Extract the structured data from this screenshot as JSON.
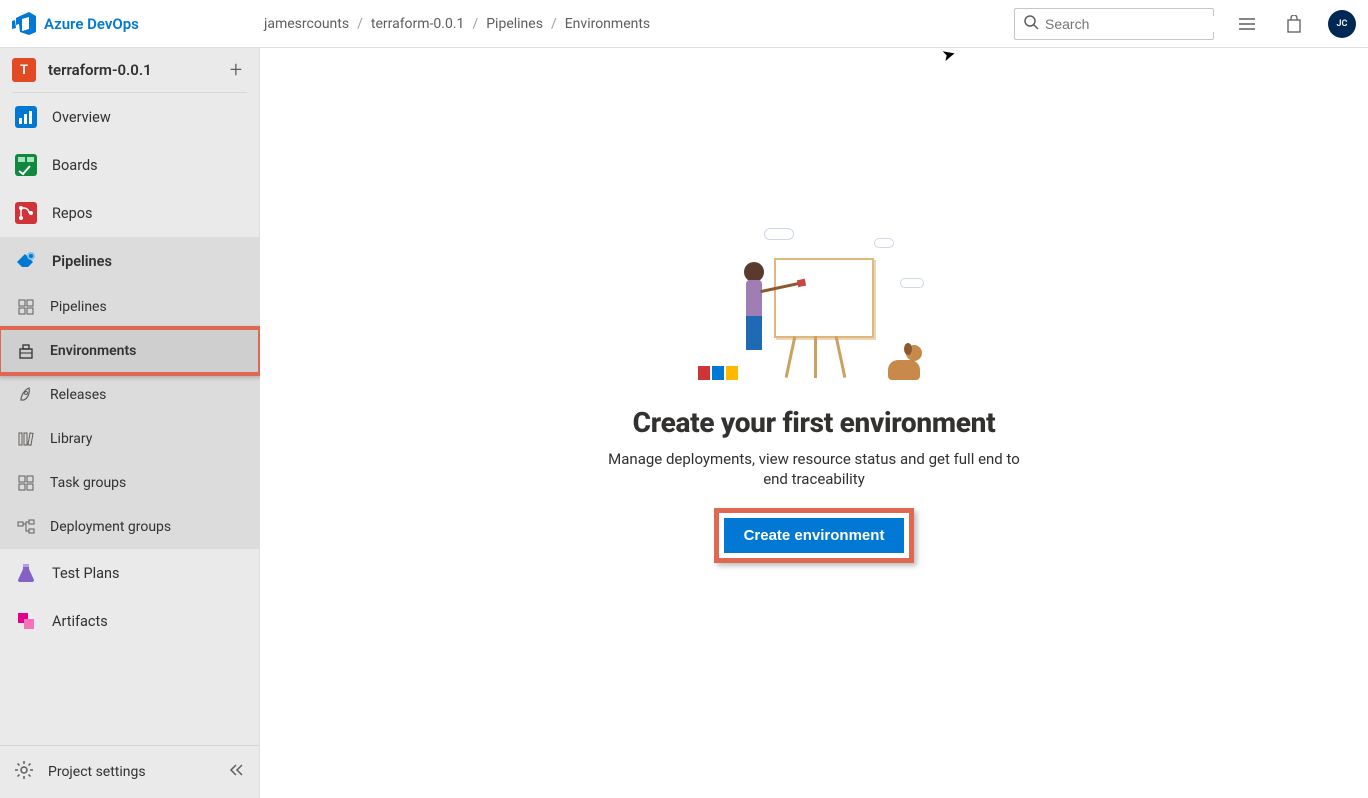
{
  "header": {
    "product": "Azure DevOps",
    "breadcrumbs": [
      "jamesrcounts",
      "terraform-0.0.1",
      "Pipelines",
      "Environments"
    ],
    "search_placeholder": "Search",
    "avatar_initials": "JC"
  },
  "sidebar": {
    "project": {
      "initial": "T",
      "name": "terraform-0.0.1"
    },
    "items": [
      {
        "label": "Overview"
      },
      {
        "label": "Boards"
      },
      {
        "label": "Repos"
      },
      {
        "label": "Pipelines",
        "active": true,
        "children": [
          {
            "label": "Pipelines"
          },
          {
            "label": "Environments",
            "current": true
          },
          {
            "label": "Releases"
          },
          {
            "label": "Library"
          },
          {
            "label": "Task groups"
          },
          {
            "label": "Deployment groups"
          }
        ]
      },
      {
        "label": "Test Plans"
      },
      {
        "label": "Artifacts"
      }
    ],
    "footer": "Project settings"
  },
  "main": {
    "title": "Create your first environment",
    "description": "Manage deployments, view resource status and get full end to end traceability",
    "button": "Create environment"
  }
}
